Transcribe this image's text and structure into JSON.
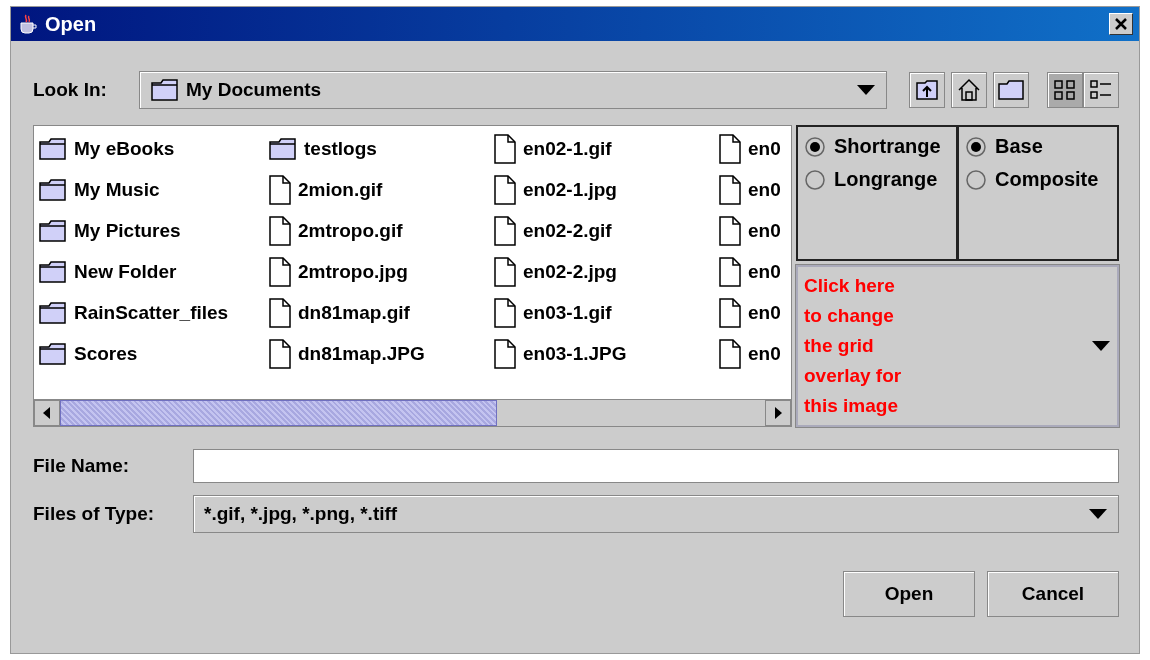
{
  "window": {
    "title": "Open"
  },
  "look_in": {
    "label": "Look In:",
    "value": "My Documents"
  },
  "toolbar": [
    {
      "kind": "up",
      "selected": false
    },
    {
      "kind": "home",
      "selected": false
    },
    {
      "kind": "new-folder",
      "selected": false
    },
    {
      "kind": "list",
      "selected": true
    },
    {
      "kind": "details",
      "selected": false
    }
  ],
  "files": [
    {
      "name": "My eBooks",
      "kind": "folder"
    },
    {
      "name": "My Music",
      "kind": "folder"
    },
    {
      "name": "My Pictures",
      "kind": "folder"
    },
    {
      "name": "New Folder",
      "kind": "folder"
    },
    {
      "name": "RainScatter_files",
      "kind": "folder"
    },
    {
      "name": "Scores",
      "kind": "folder"
    },
    {
      "name": "testlogs",
      "kind": "folder"
    },
    {
      "name": "2mion.gif",
      "kind": "file"
    },
    {
      "name": "2mtropo.gif",
      "kind": "file"
    },
    {
      "name": "2mtropo.jpg",
      "kind": "file"
    },
    {
      "name": "dn81map.gif",
      "kind": "file"
    },
    {
      "name": "dn81map.JPG",
      "kind": "file"
    },
    {
      "name": "en02-1.gif",
      "kind": "file"
    },
    {
      "name": "en02-1.jpg",
      "kind": "file"
    },
    {
      "name": "en02-2.gif",
      "kind": "file"
    },
    {
      "name": "en02-2.jpg",
      "kind": "file"
    },
    {
      "name": "en03-1.gif",
      "kind": "file"
    },
    {
      "name": "en03-1.JPG",
      "kind": "file"
    },
    {
      "name": "en0",
      "kind": "file"
    },
    {
      "name": "en0",
      "kind": "file"
    },
    {
      "name": "en0",
      "kind": "file"
    },
    {
      "name": "en0",
      "kind": "file"
    },
    {
      "name": "en0",
      "kind": "file"
    },
    {
      "name": "en0",
      "kind": "file"
    }
  ],
  "range_options": [
    {
      "label": "Shortrange",
      "selected": true
    },
    {
      "label": "Longrange",
      "selected": false
    }
  ],
  "mode_options": [
    {
      "label": "Base",
      "selected": true
    },
    {
      "label": "Composite",
      "selected": false
    }
  ],
  "grid_overlay": {
    "value": "Click here to change the grid overlay for this image"
  },
  "file_name": {
    "label": "File Name:"
  },
  "file_type": {
    "label": "Files of Type:",
    "value": "*.gif, *.jpg, *.png, *.tiff"
  },
  "buttons": [
    "Open",
    "Cancel"
  ]
}
